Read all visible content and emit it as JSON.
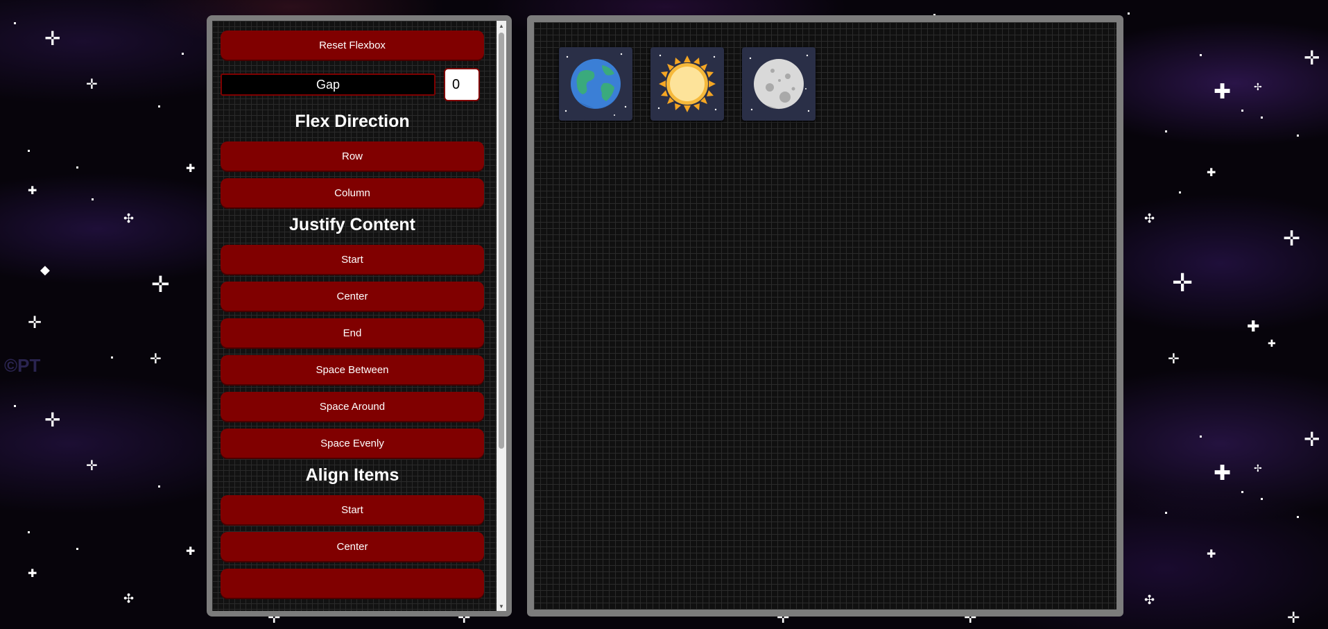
{
  "sidebar": {
    "reset_label": "Reset Flexbox",
    "gap": {
      "label": "Gap",
      "value": "0"
    },
    "sections": [
      {
        "heading": "Flex Direction",
        "buttons": [
          "Row",
          "Column"
        ]
      },
      {
        "heading": "Justify Content",
        "buttons": [
          "Start",
          "Center",
          "End",
          "Space Between",
          "Space Around",
          "Space Evenly"
        ]
      },
      {
        "heading": "Align Items",
        "buttons": [
          "Start",
          "Center"
        ]
      }
    ]
  },
  "flex_container": {
    "items": [
      {
        "name": "earth",
        "icon": "earth-icon"
      },
      {
        "name": "sun",
        "icon": "sun-icon"
      },
      {
        "name": "moon",
        "icon": "moon-icon"
      }
    ]
  },
  "background": {
    "watermark": "©PT"
  },
  "colors": {
    "button_red": "#800000",
    "frame_gray": "#7c7c7c",
    "tile_bg": "#2a2f47"
  }
}
